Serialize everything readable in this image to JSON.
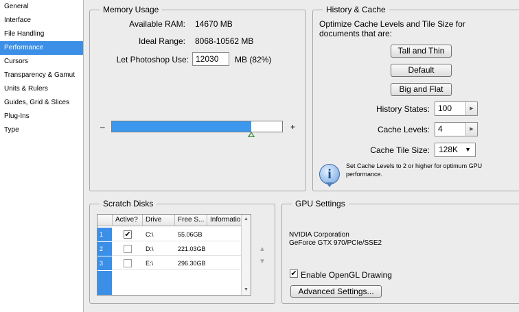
{
  "sidebar": {
    "items": [
      {
        "label": "General"
      },
      {
        "label": "Interface"
      },
      {
        "label": "File Handling"
      },
      {
        "label": "Performance"
      },
      {
        "label": "Cursors"
      },
      {
        "label": "Transparency & Gamut"
      },
      {
        "label": "Units & Rulers"
      },
      {
        "label": "Guides, Grid & Slices"
      },
      {
        "label": "Plug-Ins"
      },
      {
        "label": "Type"
      }
    ],
    "selected": "Performance"
  },
  "memory": {
    "title": "Memory Usage",
    "available_label": "Available RAM:",
    "available_value": "14670 MB",
    "ideal_label": "Ideal Range:",
    "ideal_value": "8068-10562 MB",
    "use_label": "Let Photoshop Use:",
    "use_value": "12030",
    "use_suffix": "MB (82%)",
    "minus": "–",
    "plus": "+",
    "slider_fraction": 0.82
  },
  "history": {
    "title": "History & Cache",
    "description": "Optimize Cache Levels and Tile Size for documents that are:",
    "btn_tall": "Tall and Thin",
    "btn_default": "Default",
    "btn_big": "Big and Flat",
    "states_label": "History States:",
    "states_value": "100",
    "levels_label": "Cache Levels:",
    "levels_value": "4",
    "tile_label": "Cache Tile Size:",
    "tile_value": "128K",
    "info_text": "Set Cache Levels to 2 or higher for optimum GPU performance.",
    "info_glyph": "i"
  },
  "scratch": {
    "title": "Scratch Disks",
    "columns": [
      "Active?",
      "Drive",
      "Free S...",
      "Information"
    ],
    "rows": [
      {
        "num": "1",
        "active": true,
        "drive": "C:\\",
        "free": "55.06GB",
        "info": ""
      },
      {
        "num": "2",
        "active": false,
        "drive": "D:\\",
        "free": "221.03GB",
        "info": ""
      },
      {
        "num": "3",
        "active": false,
        "drive": "E:\\",
        "free": "296.30GB",
        "info": ""
      }
    ],
    "check_glyph": "✔",
    "up_glyph": "▲",
    "down_glyph": "▼"
  },
  "gpu": {
    "title": "GPU Settings",
    "vendor": "NVIDIA Corporation",
    "model": "GeForce GTX 970/PCIe/SSE2",
    "opengl_label": "Enable OpenGL Drawing",
    "opengl_checked": true,
    "advanced_btn": "Advanced Settings..."
  },
  "colors": {
    "accent": "#3b8fe7",
    "slider_fill": "#3b98ec"
  },
  "icons": {
    "stepper": "chevron-right-icon",
    "dropdown": "chevron-down-icon",
    "info": "info-icon"
  }
}
